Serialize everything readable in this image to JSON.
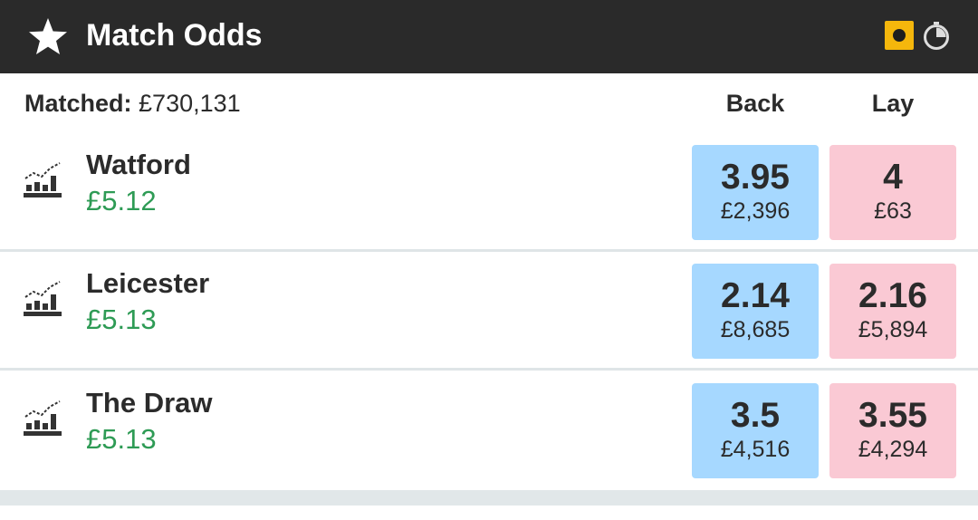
{
  "header": {
    "title": "Match Odds",
    "favourite_icon": "star-icon",
    "inplay_icon": "in-play-icon",
    "timer_icon": "timer-icon",
    "accent_color": "#f5b70c"
  },
  "summary": {
    "matched_label": "Matched:",
    "matched_value": "£730,131",
    "back_label": "Back",
    "lay_label": "Lay"
  },
  "runners": [
    {
      "name": "Watford",
      "pl": "£5.12",
      "back_odds": "3.95",
      "back_stake": "£2,396",
      "lay_odds": "4",
      "lay_stake": "£63"
    },
    {
      "name": "Leicester",
      "pl": "£5.13",
      "back_odds": "2.14",
      "back_stake": "£8,685",
      "lay_odds": "2.16",
      "lay_stake": "£5,894"
    },
    {
      "name": "The Draw",
      "pl": "£5.13",
      "back_odds": "3.5",
      "back_stake": "£4,516",
      "lay_odds": "3.55",
      "lay_stake": "£4,294"
    }
  ],
  "colors": {
    "back": "#a6d8ff",
    "lay": "#fac9d4",
    "profit": "#2e9b55",
    "header_bg": "#2a2a2a"
  }
}
